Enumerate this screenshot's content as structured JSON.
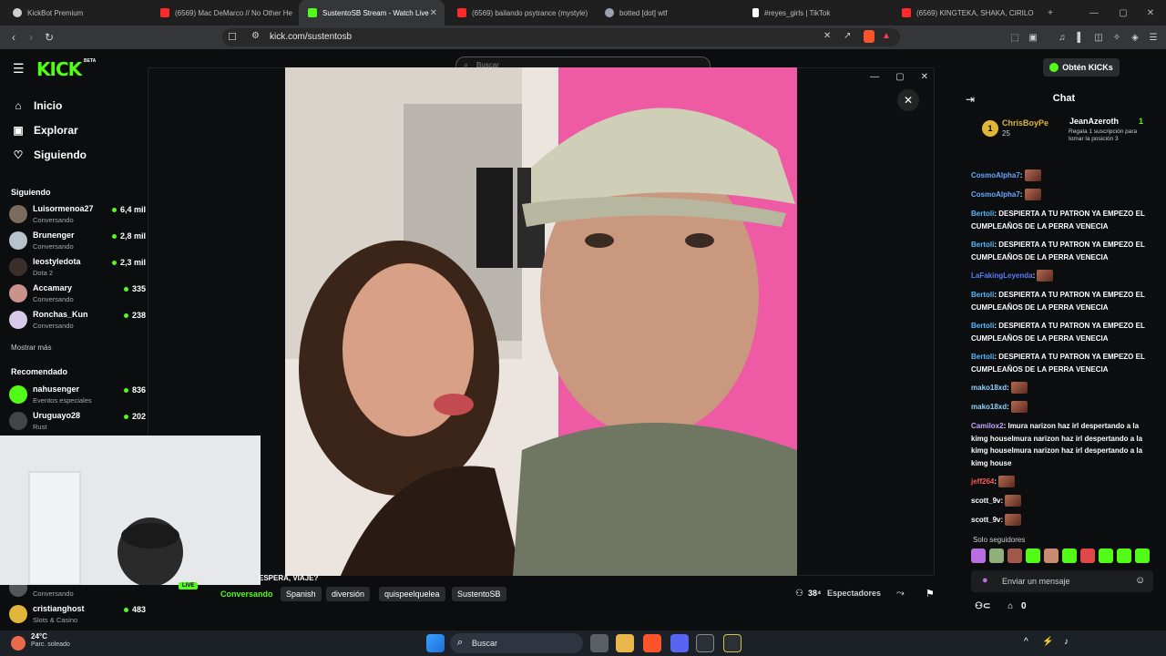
{
  "browser": {
    "tabs": [
      {
        "label": "KickBot Premium",
        "color": "#cfcfcf"
      },
      {
        "label": "(6569) Mac DeMarco // No Other He",
        "color": "#ff2a2a"
      },
      {
        "label": "SustentoSB Stream - Watch Live",
        "color": "#53fc18"
      },
      {
        "label": "(6569) bailando psytrance (mystyle)",
        "color": "#ff2a2a"
      },
      {
        "label": "botted [dot] wtf",
        "color": "#9aa3ad"
      },
      {
        "label": "#reyes_girls | TikTok",
        "color": "#ffffff"
      },
      {
        "label": "(6569) KINGTEKA, SHAKA, CIRILO Y",
        "color": "#ff2a2a"
      }
    ],
    "url": "kick.com/sustentosb",
    "new_tab": "+",
    "minimize": "—",
    "maximize": "▢",
    "close": "✕"
  },
  "kick": {
    "logo": "KICK",
    "beta": "BETA",
    "nav": [
      {
        "label": "Inicio",
        "icon": "⌂"
      },
      {
        "label": "Explorar",
        "icon": "▣"
      },
      {
        "label": "Siguiendo",
        "icon": "♡"
      }
    ],
    "following_header": "Siguiendo",
    "following": [
      {
        "name": "Luisormenoa27",
        "category": "Conversando",
        "viewers": "6,4 mil",
        "avatar": "#7a6b5d"
      },
      {
        "name": "Brunenger",
        "category": "Conversando",
        "viewers": "2,8 mil",
        "avatar": "#b7c2cc"
      },
      {
        "name": "leostyledota",
        "category": "Dota 2",
        "viewers": "2,3 mil",
        "avatar": "#3a2f2a"
      },
      {
        "name": "Accamary",
        "category": "Conversando",
        "viewers": "335",
        "avatar": "#c9928b"
      },
      {
        "name": "Ronchas_Kun",
        "category": "Conversando",
        "viewers": "238",
        "avatar": "#d9c9e8"
      }
    ],
    "show_more": "Mostrar más",
    "recommended_header": "Recomendado",
    "recommended": [
      {
        "name": "nahusenger",
        "category": "Eventos especiales",
        "viewers": "836",
        "avatar": "#53fc18"
      },
      {
        "name": "Uruguayo28",
        "category": "Rust",
        "viewers": "202",
        "avatar": "#444"
      }
    ],
    "bottom_channels": [
      {
        "name": "",
        "category": "Conversando",
        "viewers": "",
        "avatar": "#555"
      },
      {
        "name": "cristianghost",
        "category": "Slots & Casino",
        "viewers": "483",
        "avatar": "#e0b63a"
      }
    ],
    "search_placeholder": "Buscar",
    "get_kicks": "Obtén KICKs"
  },
  "stream": {
    "live": "LIVE",
    "title_fragment": "ESPERA, VIAJE?",
    "category": "Conversando",
    "tags": [
      "Spanish",
      "diversión",
      "quispeelquelea",
      "SustentoSB"
    ],
    "viewers": "38⁴",
    "viewers_label": "Espectadores"
  },
  "chat": {
    "title": "Chat",
    "pinned_user_1": "ChrisBoyPe",
    "pinned_count_1": "25",
    "pinned_user_2": "JeanAzeroth",
    "pinned_count_2": "1",
    "pinned_note": "Regala 1 suscripción para tomar la posición 3",
    "messages": [
      {
        "user": "CosmoAlpha7",
        "color": "#6aa8ff",
        "text": ""
      },
      {
        "user": "CosmoAlpha7",
        "color": "#6aa8ff",
        "text": ""
      },
      {
        "user": "Bertoli",
        "color": "#53b9ff",
        "text": "DESPIERTA A TU PATRON YA EMPEZO EL CUMPLEAÑOS DE LA PERRA VENECIA"
      },
      {
        "user": "Bertoli",
        "color": "#53b9ff",
        "text": "DESPIERTA A TU PATRON YA EMPEZO EL CUMPLEAÑOS DE LA PERRA VENECIA"
      },
      {
        "user": "LaFakingLeyenda",
        "color": "#5b7cff",
        "text": ""
      },
      {
        "user": "Bertoli",
        "color": "#53b9ff",
        "text": "DESPIERTA A TU PATRON YA EMPEZO EL CUMPLEAÑOS DE LA PERRA VENECIA"
      },
      {
        "user": "Bertoli",
        "color": "#53b9ff",
        "text": "DESPIERTA A TU PATRON YA EMPEZO EL CUMPLEAÑOS DE LA PERRA VENECIA"
      },
      {
        "user": "Bertoli",
        "color": "#53b9ff",
        "text": "DESPIERTA A TU PATRON YA EMPEZO EL CUMPLEAÑOS DE LA PERRA VENECIA"
      },
      {
        "user": "mako18xd",
        "color": "#8fd3ff",
        "text": ""
      },
      {
        "user": "mako18xd",
        "color": "#8fd3ff",
        "text": ""
      },
      {
        "user": "Camilox2",
        "color": "#c9a6ff",
        "text": "lmura narizon haz irl despertando a la kimg houselmura narizon haz irl despertando a la kimg houselmura narizon haz irl despertando a la kimg house"
      },
      {
        "user": "jeff264",
        "color": "#ff5b5b",
        "text": ""
      },
      {
        "user": "scott_9v",
        "color": "#ffffff",
        "text": ""
      },
      {
        "user": "scott_9v",
        "color": "#ffffff",
        "text": ""
      }
    ],
    "followers_only": "Solo seguidores",
    "input_placeholder": "Enviar un mensaje",
    "kicks_count": "0"
  },
  "taskbar": {
    "temperature": "24°C",
    "weather": "Parc. soleado",
    "search": "Buscar"
  }
}
